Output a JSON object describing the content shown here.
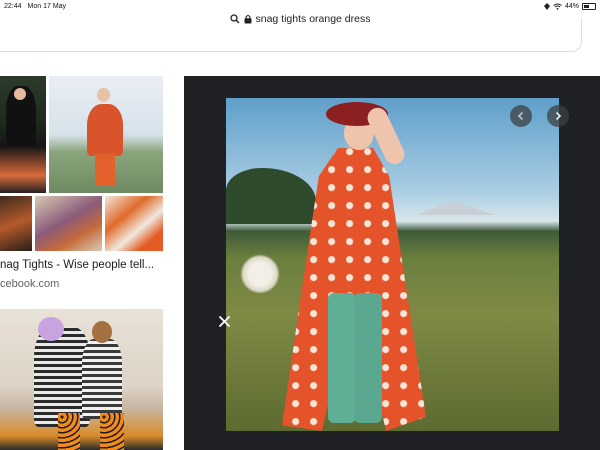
{
  "status": {
    "time": "22:44",
    "date": "Mon 17 May",
    "battery": "44%"
  },
  "address": {
    "text": "snag tights orange dress"
  },
  "results": {
    "caption": "nag Tights - Wise people tell...",
    "source": "cebook.com"
  },
  "icons": {
    "search": "search-icon",
    "lock": "lock-icon",
    "prev": "chevron-left-icon",
    "next": "chevron-right-icon",
    "close": "close-icon",
    "wifi": "wifi-icon",
    "battery": "battery-icon"
  },
  "colors": {
    "viewer_bg": "#202124",
    "accent_dress": "#e5532a",
    "tights": "#5fae96"
  }
}
